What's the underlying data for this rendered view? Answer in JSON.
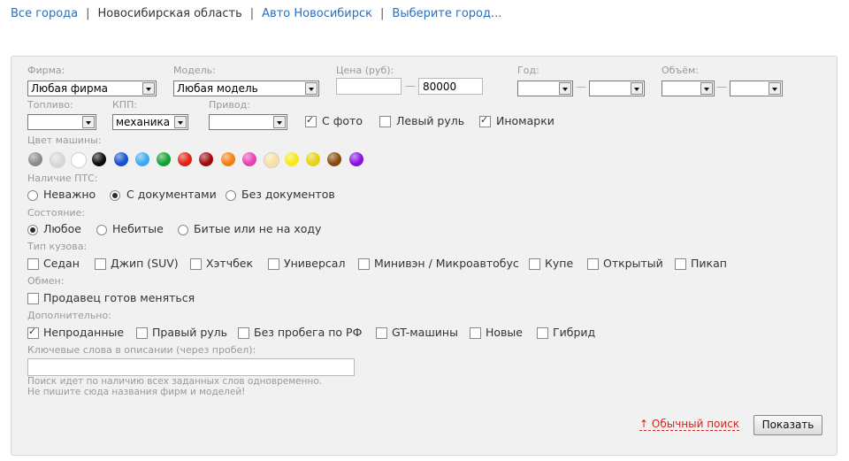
{
  "breadcrumbs": {
    "all_cities": "Все города",
    "region": "Новосибирская область",
    "auto_city": "Авто Новосибирск",
    "choose_city": "Выберите город..."
  },
  "filters": {
    "firm": {
      "label": "Фирма:",
      "value": "Любая фирма"
    },
    "model": {
      "label": "Модель:",
      "value": "Любая модель"
    },
    "price": {
      "label": "Цена (руб):",
      "from": "",
      "to": "80000"
    },
    "year": {
      "label": "Год:",
      "from": "",
      "to": ""
    },
    "volume": {
      "label": "Объём:",
      "from": "",
      "to": ""
    },
    "fuel": {
      "label": "Топливо:",
      "value": ""
    },
    "gearbox": {
      "label": "КПП:",
      "value": "механика"
    },
    "drive": {
      "label": "Привод:",
      "value": ""
    },
    "with_photo": {
      "label": "С фото",
      "checked": true
    },
    "left_wheel": {
      "label": "Левый руль",
      "checked": false
    },
    "foreign": {
      "label": "Иномарки",
      "checked": true
    },
    "dash_sep": "—"
  },
  "colors": {
    "label": "Цвет машины:",
    "swatches": [
      {
        "name": "grey",
        "hex": "#8a8a8a"
      },
      {
        "name": "silver",
        "hex": "#d8d8d8"
      },
      {
        "name": "white",
        "hex": "#ffffff"
      },
      {
        "name": "black",
        "hex": "#0a0a0a"
      },
      {
        "name": "blue",
        "hex": "#1450d0"
      },
      {
        "name": "light-blue",
        "hex": "#3aaaf0"
      },
      {
        "name": "green",
        "hex": "#14a030"
      },
      {
        "name": "red",
        "hex": "#e02010"
      },
      {
        "name": "dark-red",
        "hex": "#a00810"
      },
      {
        "name": "orange",
        "hex": "#f08010"
      },
      {
        "name": "pink",
        "hex": "#e840b0"
      },
      {
        "name": "beige",
        "hex": "#f8e0a8"
      },
      {
        "name": "yellow",
        "hex": "#f8e818"
      },
      {
        "name": "gold",
        "hex": "#e8d010"
      },
      {
        "name": "brown",
        "hex": "#8a4808"
      },
      {
        "name": "purple",
        "hex": "#8810e0"
      }
    ]
  },
  "pts": {
    "label": "Наличие ПТС:",
    "options": [
      "Неважно",
      "С документами",
      "Без документов"
    ],
    "selected": 1
  },
  "condition": {
    "label": "Состояние:",
    "options": [
      "Любое",
      "Небитые",
      "Битые или не на ходу"
    ],
    "selected": 0
  },
  "body_type": {
    "label": "Тип кузова:",
    "options": [
      "Седан",
      "Джип (SUV)",
      "Хэтчбек",
      "Универсал",
      "Минивэн / Микроавтобус",
      "Купе",
      "Открытый",
      "Пикап"
    ]
  },
  "exchange": {
    "label": "Обмен:",
    "option": "Продавец готов меняться"
  },
  "additional": {
    "label": "Дополнительно:",
    "options": [
      {
        "text": "Непроданные",
        "checked": true
      },
      {
        "text": "Правый руль",
        "checked": false
      },
      {
        "text": "Без пробега по РФ",
        "checked": false
      },
      {
        "text": "GT-машины",
        "checked": false
      },
      {
        "text": "Новые",
        "checked": false
      },
      {
        "text": "Гибрид",
        "checked": false
      }
    ]
  },
  "keywords": {
    "label": "Ключевые слова в описании (через пробел):",
    "value": "",
    "hint1": "Поиск идет по наличию всех заданных слов одновременно.",
    "hint2": "Не пишите сюда названия фирм и моделей!"
  },
  "actions": {
    "simple_search": "↑ Обычный поиск",
    "show": "Показать"
  }
}
